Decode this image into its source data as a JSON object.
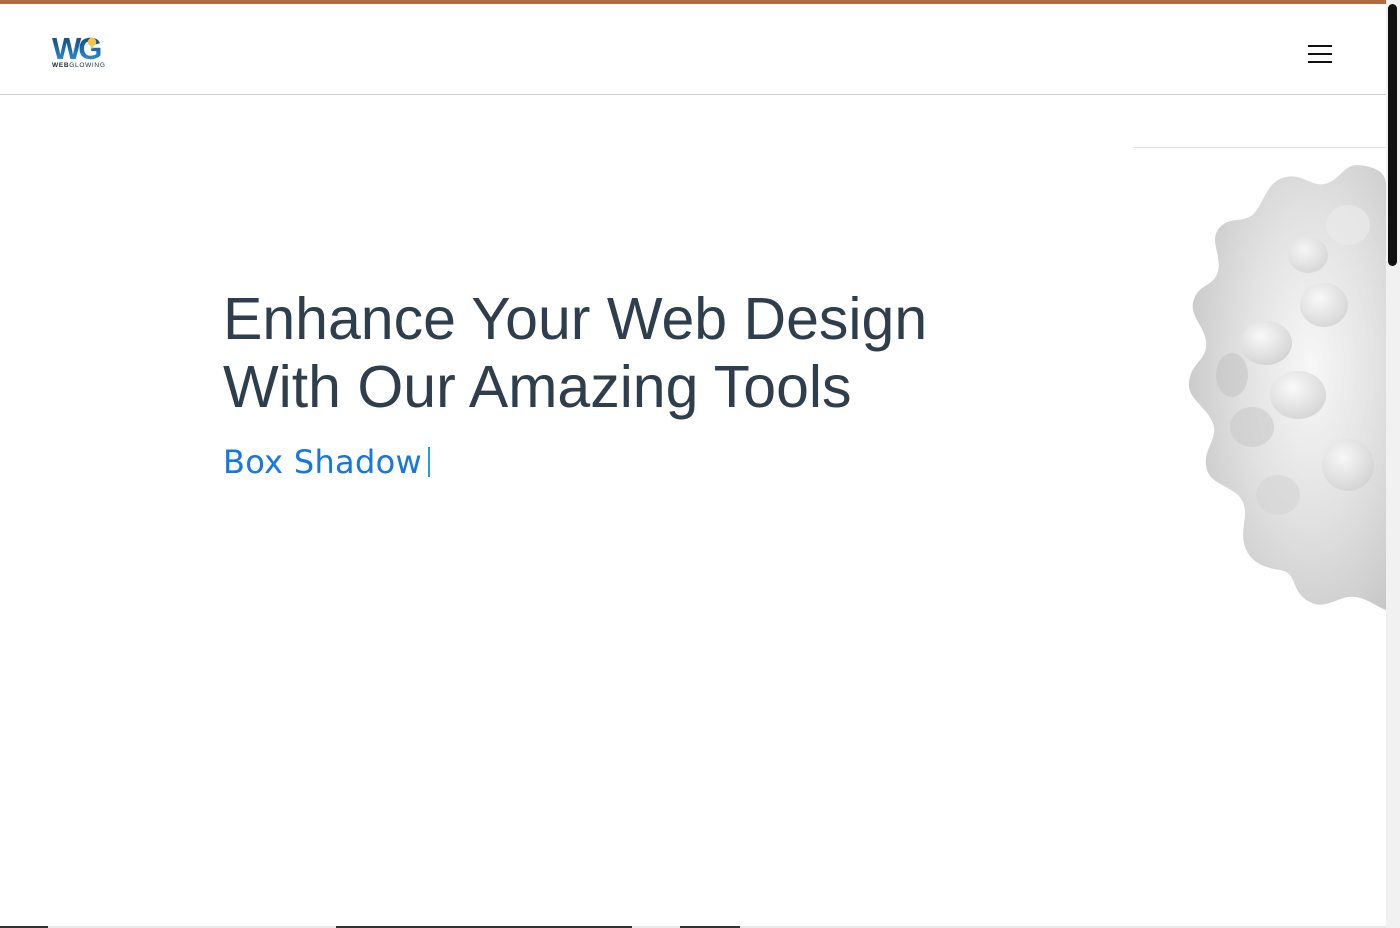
{
  "logo": {
    "mark": "WG",
    "wordmark_bold": "WEB",
    "wordmark_light": "GLOWING"
  },
  "header": {
    "menu_icon": "hamburger-menu-icon"
  },
  "hero": {
    "headline_line1": "Enhance Your Web Design",
    "headline_line2": "With Our Amazing Tools",
    "typed_text": "Box Shadow",
    "decoration": "3d-blob-sphere"
  },
  "colors": {
    "accent_bar": "#b06a3f",
    "headline": "#2f3e4d",
    "typed_text": "#1576e6",
    "cursor": "#1ea0f0",
    "logo_navy": "#1c2b3c",
    "logo_blue": "#1c6fb0"
  }
}
